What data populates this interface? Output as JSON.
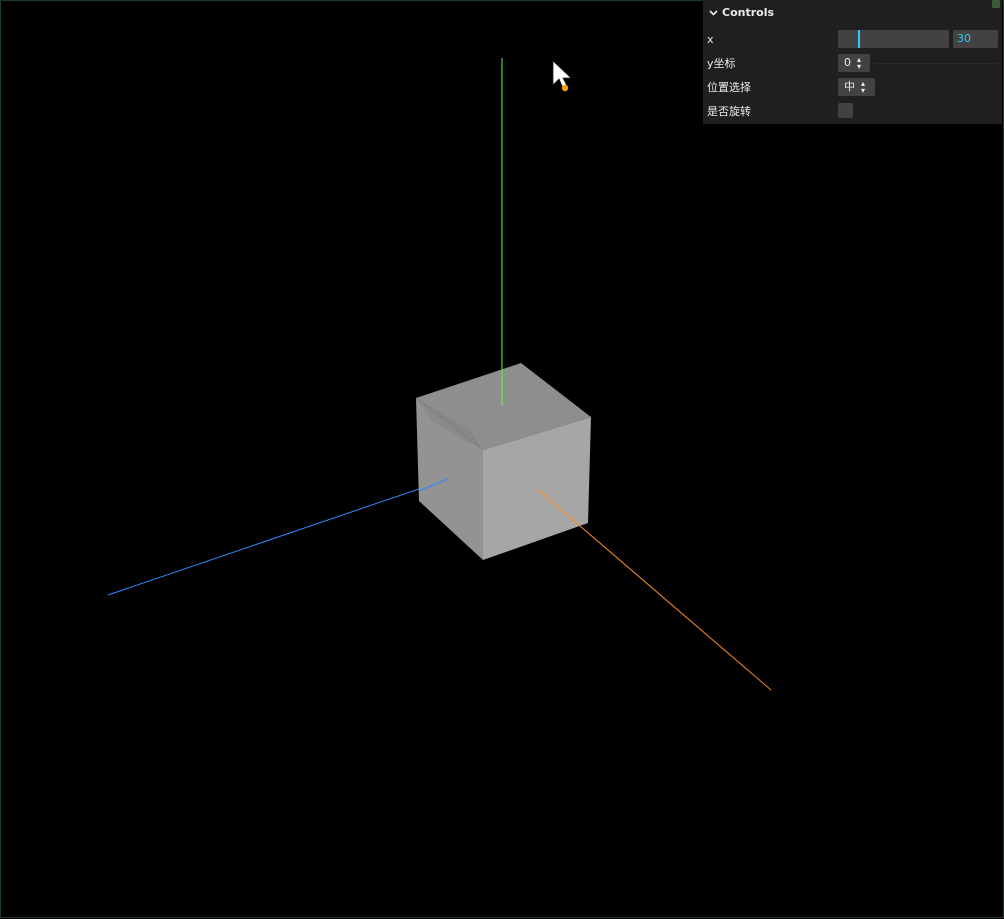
{
  "gui": {
    "title": "Controls",
    "x_label": "x",
    "x_value": "30",
    "x_slider_fraction": 0.18,
    "y_label": "y坐标",
    "y_value": "0",
    "position_label": "位置选择",
    "position_value": "中",
    "rotate_label": "是否旋转",
    "rotate_checked": false,
    "accent_color": "#2cc9ff"
  },
  "scene": {
    "background": "#000000",
    "cube_colors": {
      "top": "#8e8e8e",
      "front": "#a6a6a6",
      "left": "#939393"
    },
    "axis_colors": {
      "x": "#ff8a1f",
      "y": "#5cff3a",
      "z": "#2f8cff"
    },
    "cursor_icon": "arrow-cursor-icon"
  }
}
